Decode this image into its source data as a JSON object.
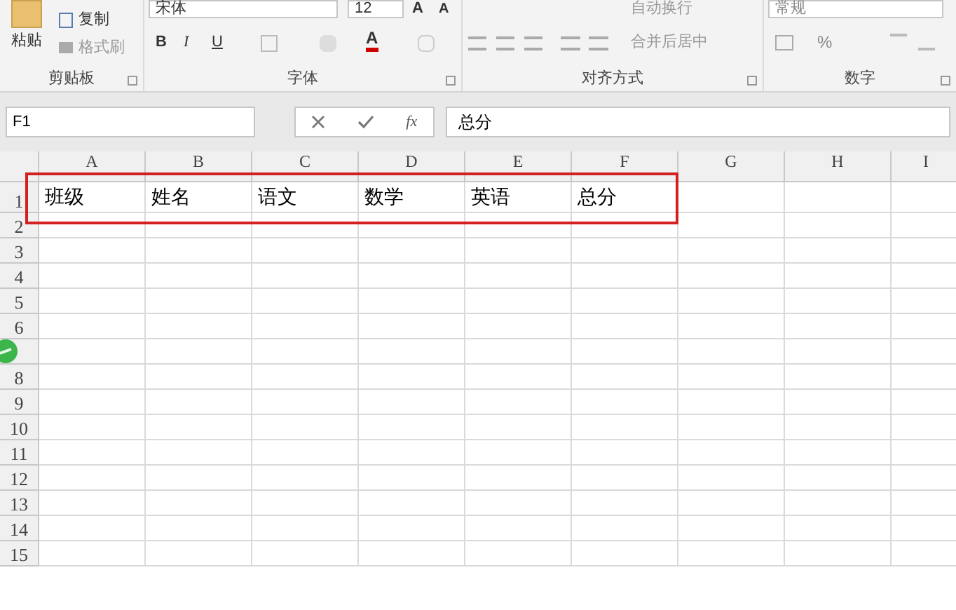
{
  "ribbon": {
    "clipboard": {
      "paste": "粘贴",
      "copy": "复制",
      "format_painter": "格式刷",
      "group_label": "剪贴板"
    },
    "font": {
      "font_name": "宋体",
      "font_size": "12",
      "grow": "A",
      "shrink": "A",
      "bold": "B",
      "italic": "I",
      "underline": "U",
      "font_color": "A",
      "group_label": "字体"
    },
    "alignment": {
      "wrap_text": "自动换行",
      "merge_center": "合并后居中",
      "group_label": "对齐方式"
    },
    "number": {
      "format": "常规",
      "percent": "%",
      "group_label": "数字"
    }
  },
  "formula_bar": {
    "name_box": "F1",
    "fx": "fx",
    "formula": "总分"
  },
  "sheet": {
    "columns": [
      "A",
      "B",
      "C",
      "D",
      "E",
      "F",
      "G",
      "H",
      "I"
    ],
    "rows": [
      {
        "header": "1",
        "cells": [
          "班级",
          "姓名",
          "语文",
          "数学",
          "英语",
          "总分"
        ]
      },
      {
        "header": "2",
        "cells": []
      },
      {
        "header": "3",
        "cells": []
      },
      {
        "header": "4",
        "cells": []
      },
      {
        "header": "5",
        "cells": []
      },
      {
        "header": "6",
        "cells": []
      },
      {
        "cells": []
      },
      {
        "header": "8",
        "cells": []
      },
      {
        "header": "9",
        "cells": []
      },
      {
        "header": "10",
        "cells": []
      },
      {
        "header": "11",
        "cells": []
      },
      {
        "header": "12",
        "cells": []
      },
      {
        "header": "13",
        "cells": []
      },
      {
        "header": "14",
        "cells": []
      },
      {
        "header": "15",
        "cells": []
      }
    ]
  }
}
